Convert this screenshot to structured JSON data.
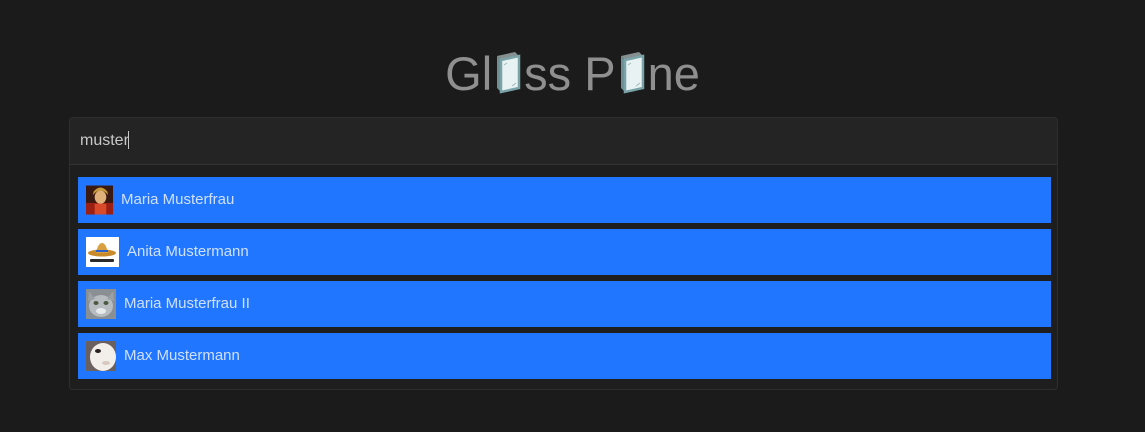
{
  "app": {
    "logo_part1": "Gl",
    "logo_part2": "ss P",
    "logo_part3": "ne"
  },
  "search": {
    "value": "muster",
    "placeholder": ""
  },
  "results": [
    {
      "name": "Maria Musterfrau",
      "avatar": "portrait-red-avatar"
    },
    {
      "name": "Anita Mustermann",
      "avatar": "sombrero-avatar"
    },
    {
      "name": "Maria Musterfrau II",
      "avatar": "cat-face-avatar"
    },
    {
      "name": "Max Mustermann",
      "avatar": "white-face-avatar"
    }
  ],
  "colors": {
    "background": "#1b1b1b",
    "accent": "#2176ff",
    "logo": "#8f8f8f"
  }
}
